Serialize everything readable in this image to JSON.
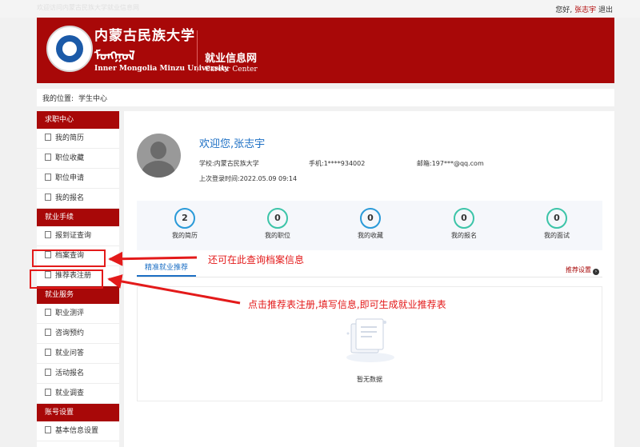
{
  "topbar": {
    "welcome": "欢迎访问内蒙古民族大学就业信息网",
    "greeting": "您好,",
    "username": "张志宇",
    "logout": "退出"
  },
  "banner": {
    "school_cn": "内蒙古民族大学",
    "school_mongolian": "ᠮᠣᠩᠭᠣᠯ",
    "school_en": "Inner Mongolia Minzu University",
    "center_cn": "就业信息网",
    "center_en": "Career Center"
  },
  "breadcrumb": {
    "label": "我的位置:",
    "current": "学生中心"
  },
  "sidebar": {
    "sections": [
      {
        "title": "求职中心",
        "items": [
          "我的简历",
          "职位收藏",
          "职位申请",
          "我的报名"
        ]
      },
      {
        "title": "就业手续",
        "items": [
          "报到证查询",
          "档案查询",
          "推荐表注册"
        ]
      },
      {
        "title": "就业服务",
        "items": [
          "职业测评",
          "咨询预约",
          "就业问答",
          "活动报名",
          "就业调查"
        ]
      },
      {
        "title": "账号设置",
        "items": [
          "基本信息设置"
        ]
      }
    ]
  },
  "profile": {
    "welcome": "欢迎您,张志宇",
    "school": "学校:内蒙古民族大学",
    "phone": "手机:1****934002",
    "email": "邮箱:197***@qq.com",
    "last_login": "上次登录时间:2022.05.09 09:14"
  },
  "stats": [
    {
      "value": "2",
      "label": "我的简历",
      "color": "#2a9ad8"
    },
    {
      "value": "0",
      "label": "我的职位",
      "color": "#3cc4a8"
    },
    {
      "value": "0",
      "label": "我的收藏",
      "color": "#2a9ad8"
    },
    {
      "value": "0",
      "label": "我的报名",
      "color": "#3cc4a8"
    },
    {
      "value": "0",
      "label": "我的面试",
      "color": "#3cc4a8"
    }
  ],
  "recommend": {
    "tab": "精准就业推荐",
    "settings": "推荐设置",
    "empty": "暂无数据"
  },
  "annotations": {
    "archive": "还可在此查询档案信息",
    "register": "点击推荐表注册,填写信息,即可生成就业推荐表"
  },
  "colors": {
    "brand": "#a80808",
    "accent": "#1c6fc4",
    "annotation": "#e31a1a"
  }
}
